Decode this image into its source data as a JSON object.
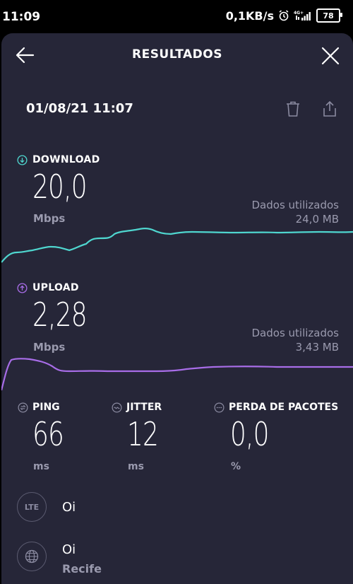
{
  "status_bar": {
    "time": "11:09",
    "speed": "0,1KB/s",
    "network": "4G+",
    "battery": "78"
  },
  "header": {
    "title": "RESULTADOS"
  },
  "test": {
    "datetime": "01/08/21 11:07"
  },
  "download": {
    "label": "DOWNLOAD",
    "value": "20,0",
    "unit": "Mbps",
    "data_label": "Dados utilizados",
    "data_value": "24,0 MB",
    "color": "#4fd6cf"
  },
  "upload": {
    "label": "UPLOAD",
    "value": "2,28",
    "unit": "Mbps",
    "data_label": "Dados utilizados",
    "data_value": "3,43 MB",
    "color": "#a86de8"
  },
  "ping": {
    "label": "PING",
    "value": "66",
    "unit": "ms"
  },
  "jitter": {
    "label": "JITTER",
    "value": "12",
    "unit": "ms"
  },
  "packet_loss": {
    "label": "PERDA DE PACOTES",
    "value": "0,0",
    "unit": "%"
  },
  "provider": {
    "icon_text": "LTE",
    "name": "Oi"
  },
  "server": {
    "name": "Oi",
    "city": "Recife"
  }
}
